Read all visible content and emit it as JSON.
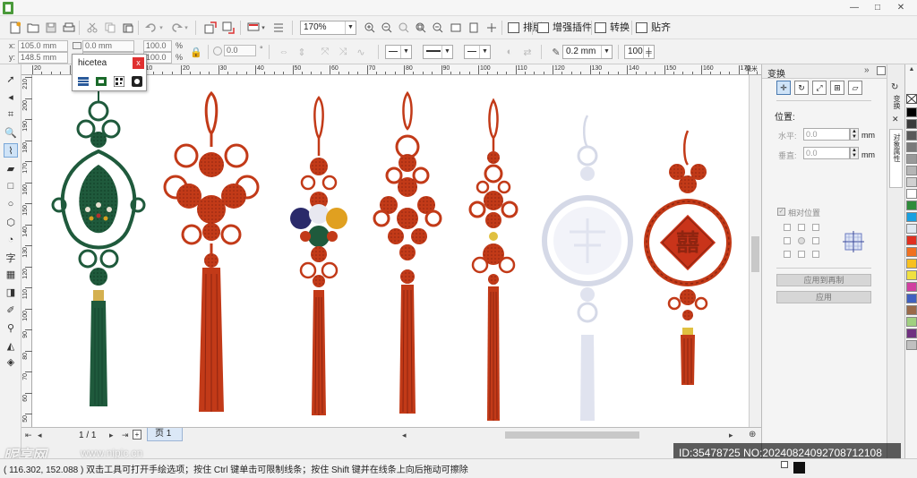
{
  "titlebar": {
    "minimize": "—",
    "maximize": "□",
    "close": "✕"
  },
  "toolbar": {
    "zoom_value": "170%",
    "menus": [
      "排版",
      "增强插件",
      "转换",
      "贴齐"
    ],
    "outline_width": "0.2 mm",
    "number_value": "100"
  },
  "propbar": {
    "x_label": "x:",
    "x_value": "105.0 mm",
    "y_label": "y:",
    "y_value": "148.5 mm",
    "w_value": "0.0 mm",
    "scale_x": "100.0",
    "scale_y": "100.0",
    "pct": "%",
    "angle": "0.0",
    "deg": "°"
  },
  "ruler": {
    "top_ticks": [
      "20",
      "10",
      "0",
      "10",
      "20",
      "30",
      "40",
      "50",
      "60",
      "70",
      "80",
      "90",
      "100",
      "110",
      "120",
      "130",
      "140",
      "150",
      "160",
      "170",
      "180",
      "190"
    ],
    "unit": "毫米",
    "left_ticks": [
      "210",
      "200",
      "190",
      "180",
      "170",
      "160",
      "150",
      "140",
      "130",
      "120",
      "110",
      "100",
      "90",
      "80",
      "70",
      "60",
      "50"
    ]
  },
  "popup": {
    "title": "hicetea",
    "close": "x"
  },
  "docker": {
    "title": "变换",
    "position_label": "位置:",
    "h_label": "水平:",
    "h_value": "0.0",
    "v_label": "垂直:",
    "v_value": "0.0",
    "unit": "mm",
    "relative_label": "相对位置",
    "apply_copy": "应用到再制",
    "apply": "应用"
  },
  "sidetabs": [
    "变换",
    "对象属性"
  ],
  "pagebar": {
    "page_count": "1 / 1",
    "page_tab": "页 1"
  },
  "status": {
    "text": "( 116.302, 152.088 )   双击工具可打开手绘选项；按住 Ctrl 键单击可限制线条；按住 Shift 键并在线条上向后拖动可擦除"
  },
  "watermark": {
    "logo": "昵享网",
    "url": "www.nipic.cn",
    "id_text": "ID:35478725 NO:20240824092708712108"
  },
  "colors": {
    "knot_red": "#c23a18",
    "knot_dark": "#8f2410",
    "knot_green": "#1f5a3c",
    "faded": "#c8cde0",
    "palette": [
      "#000000",
      "#3a3a3a",
      "#595959",
      "#7a7a7a",
      "#999999",
      "#b5b5b5",
      "#d0d0d0",
      "#ffffff",
      "#2e8b3a",
      "#1aa0e0",
      "#e0e8f0",
      "#e03020",
      "#f07020",
      "#f8c020",
      "#f0e040",
      "#d040a0",
      "#4060c0",
      "#9a6a4a",
      "#a0d080",
      "#703080",
      "#c0c0c0"
    ]
  }
}
